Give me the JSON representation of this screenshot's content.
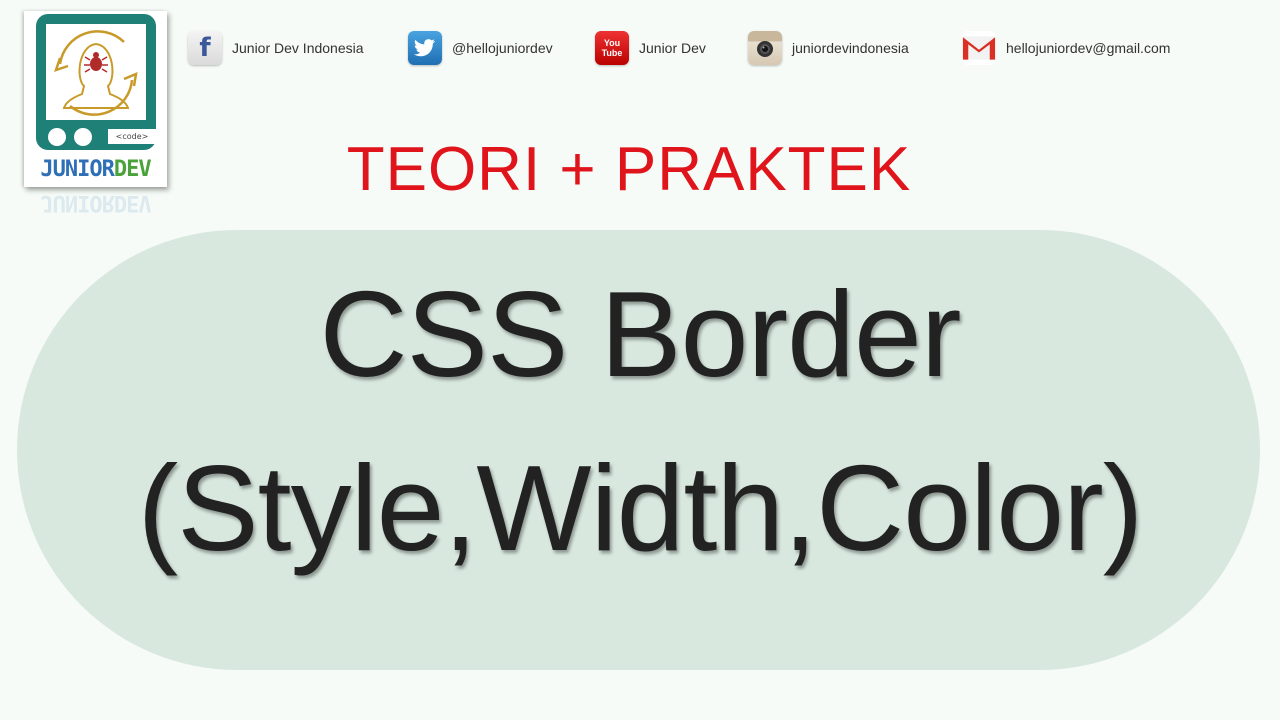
{
  "logo": {
    "code_label": "<code>",
    "brand_part1": "JUNIOR",
    "brand_part2": "DEV",
    "brand_colors": {
      "junior": "#2e6fb5",
      "dev": "#4aa33a",
      "frame": "#1f8078"
    }
  },
  "social": [
    {
      "icon": "facebook-icon",
      "label": "Junior Dev Indonesia"
    },
    {
      "icon": "twitter-icon",
      "label": "@hellojuniordev"
    },
    {
      "icon": "youtube-icon",
      "label": "Junior Dev",
      "icon_text_top": "You",
      "icon_text_bottom": "Tube"
    },
    {
      "icon": "instagram-icon",
      "label": "juniordevindonesia"
    },
    {
      "icon": "gmail-icon",
      "label": "hellojuniordev@gmail.com"
    }
  ],
  "subtitle": "TEORI + PRAKTEK",
  "title": {
    "line1": "CSS Border",
    "line2": "(Style,Width,Color)"
  },
  "colors": {
    "background": "#f6fbf7",
    "pill": "#d8e8df",
    "subtitle": "#e0141b",
    "title": "#222222"
  }
}
